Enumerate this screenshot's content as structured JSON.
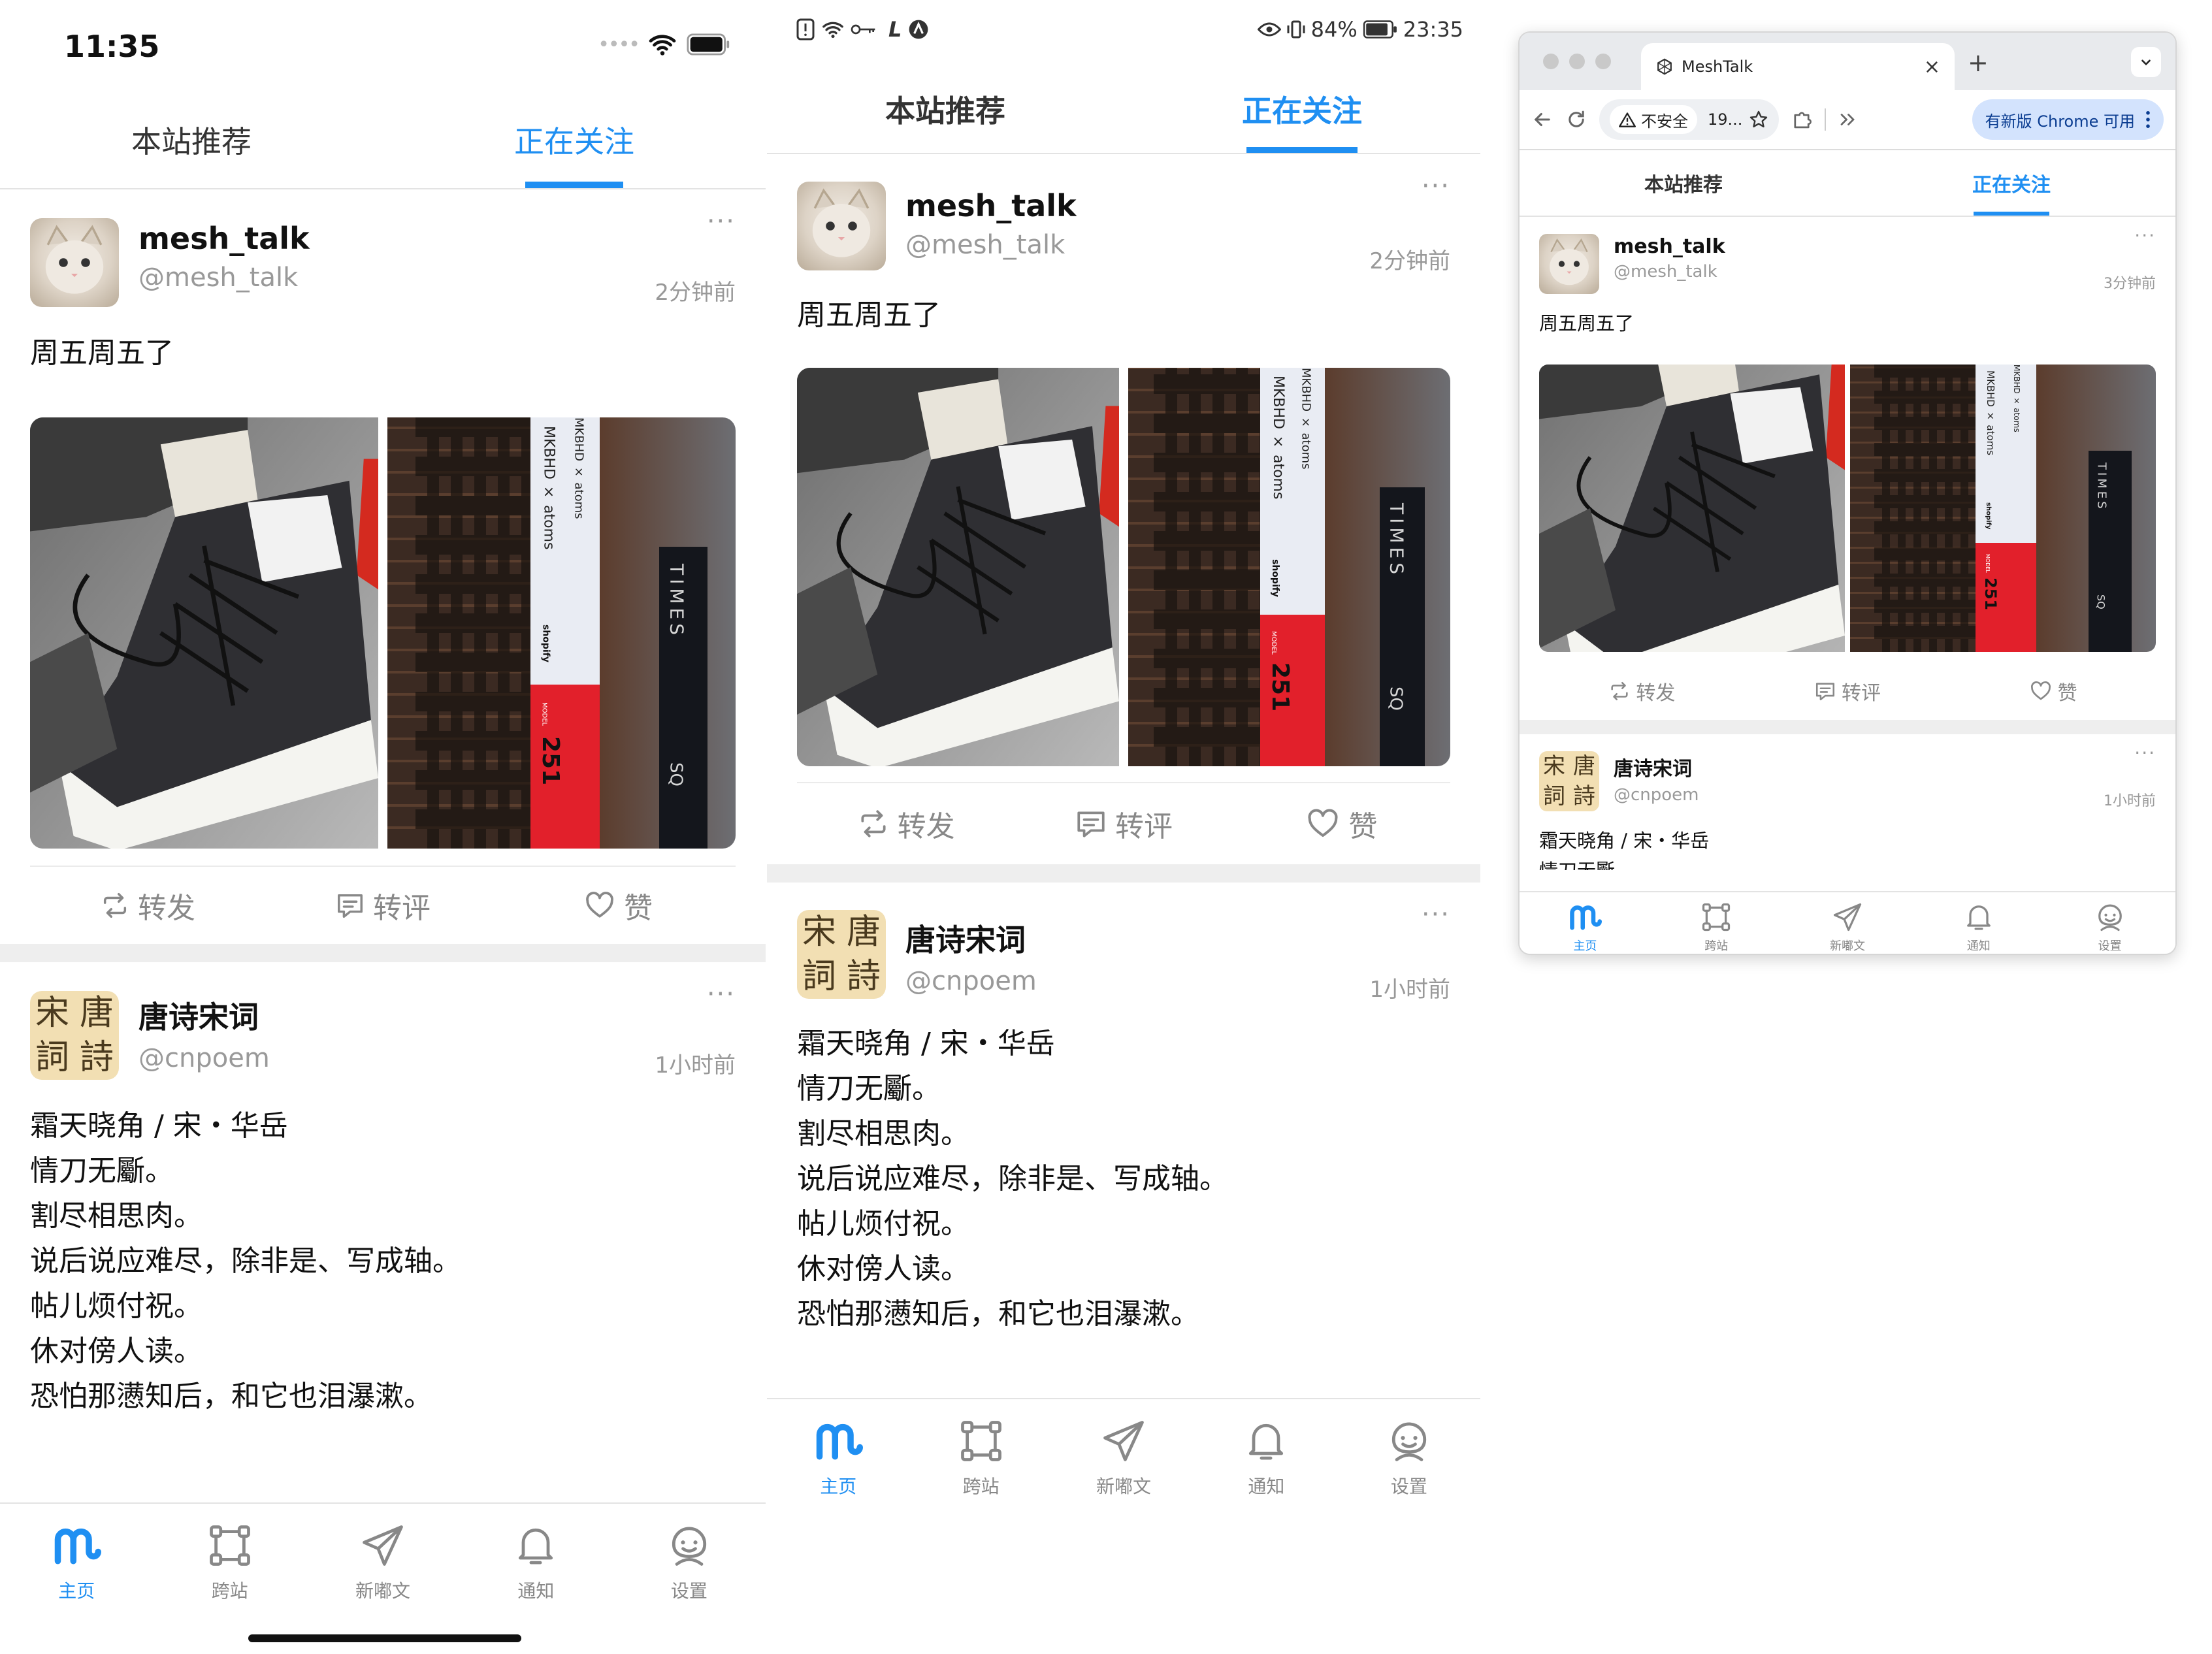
{
  "ios": {
    "clock": "11:35"
  },
  "android": {
    "status_left_letter": "L",
    "battery": "84%",
    "clock": "23:35"
  },
  "browser": {
    "tab_title": "MeshTalk",
    "tab_close": "×",
    "new_tab": "+",
    "not_secure": "不安全",
    "url": "19...",
    "update_chip": "有新版 Chrome 可用"
  },
  "tabs": {
    "recommend": "本站推荐",
    "following": "正在关注"
  },
  "posts": [
    {
      "name": "mesh_talk",
      "handle": "@mesh_talk",
      "time": "2分钟前",
      "time_desktop": "3分钟前",
      "text": [
        "周五周五了"
      ],
      "image_text": {
        "tower_left": "MKBHD × atoms",
        "tower_right": "MKBHD × atoms",
        "shopify": "shopify",
        "model": "MODEL",
        "number": "251",
        "times": "TIMES",
        "sq": "SQ"
      }
    },
    {
      "name": "唐诗宋词",
      "handle": "@cnpoem",
      "time": "1小时前",
      "avatar_chars": [
        "宋",
        "唐",
        "詞",
        "詩"
      ],
      "text": [
        "霜天晓角 / 宋・华岳",
        "情刀无斸。",
        "割尽相思肉。",
        "说后说应难尽，除非是、写成轴。",
        "帖儿烦付祝。",
        "休对傍人读。",
        "恐怕那懑知后，和它也泪瀑漱。"
      ]
    }
  ],
  "more": "···",
  "actions": {
    "repost": "转发",
    "comment": "转评",
    "like": "赞"
  },
  "nav": {
    "home": "主页",
    "cross_site": "跨站",
    "new_post": "新嘟文",
    "notify": "通知",
    "settings": "设置"
  },
  "colors": {
    "accent": "#1f8ff2",
    "muted": "#888888",
    "divider": "#eeeeee"
  },
  "icons": [
    "wifi-icon",
    "battery-icon",
    "repost-icon",
    "comment-icon",
    "heart-icon",
    "home-logo-icon",
    "cross-site-icon",
    "paper-plane-icon",
    "bell-icon",
    "settings-face-icon",
    "back-icon",
    "reload-icon",
    "warning-icon",
    "star-icon",
    "extension-icon",
    "chevron-double-icon",
    "kebab-icon",
    "chevron-down-icon",
    "eye-icon",
    "vibrate-icon",
    "key-icon"
  ]
}
